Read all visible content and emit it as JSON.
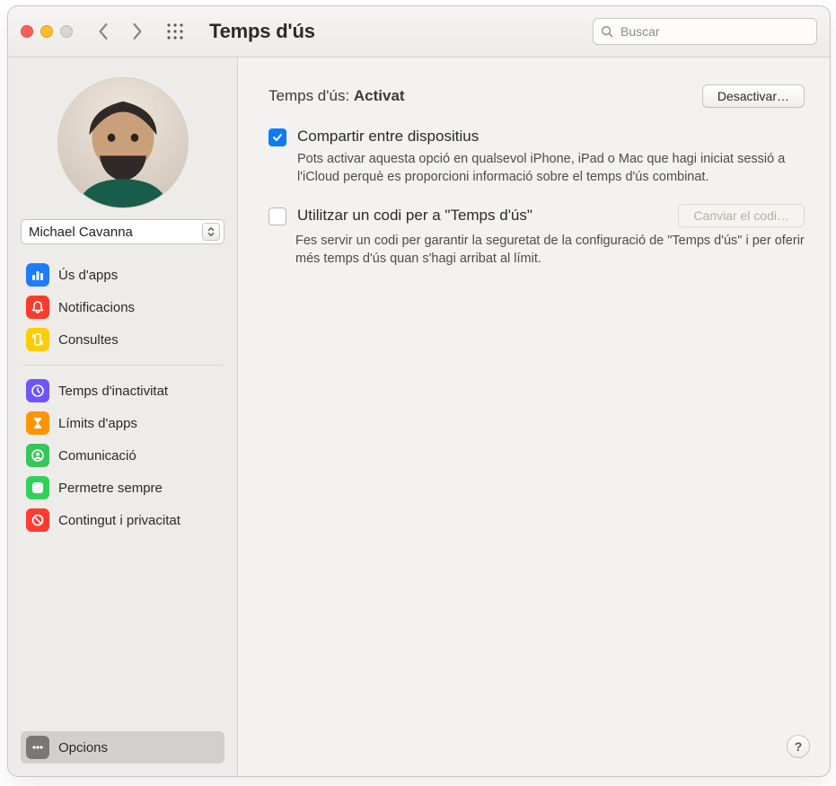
{
  "window": {
    "title": "Temps d'ús"
  },
  "search": {
    "placeholder": "Buscar"
  },
  "user": {
    "name": "Michael Cavanna"
  },
  "sidebar": {
    "group1": [
      {
        "key": "app-usage",
        "label": "Ús d'apps",
        "icon": "bar-chart-icon",
        "color": "#1f7bff"
      },
      {
        "key": "notifications",
        "label": "Notificacions",
        "icon": "bell-icon",
        "color": "#ff3b30"
      },
      {
        "key": "pickups",
        "label": "Consultes",
        "icon": "phone-swap-icon",
        "color": "#ffcc00"
      }
    ],
    "group2": [
      {
        "key": "downtime",
        "label": "Temps d'inactivitat",
        "icon": "clock-moon-icon",
        "color": "#6d55ff"
      },
      {
        "key": "app-limits",
        "label": "Límits d'apps",
        "icon": "hourglass-icon",
        "color": "#ff9500"
      },
      {
        "key": "communication",
        "label": "Comunicació",
        "icon": "person-circle-icon",
        "color": "#34c759"
      },
      {
        "key": "always-allowed",
        "label": "Permetre sempre",
        "icon": "check-shield-icon",
        "color": "#30d158"
      },
      {
        "key": "content-privacy",
        "label": "Contingut i privacitat",
        "icon": "no-sign-icon",
        "color": "#ff3b30"
      }
    ],
    "bottom": {
      "key": "options",
      "label": "Opcions",
      "icon": "ellipsis-icon",
      "color": "#7a7875",
      "selected": true
    }
  },
  "content": {
    "status_label": "Temps d'ús:",
    "status_value": "Activat",
    "deactivate_button": "Desactivar…",
    "share": {
      "checked": true,
      "title": "Compartir entre dispositius",
      "desc": "Pots activar aquesta opció en qualsevol iPhone, iPad o Mac que hagi iniciat sessió a l'iCloud perquè es proporcioni informació sobre el temps d'ús combinat."
    },
    "code": {
      "checked": false,
      "title": "Utilitzar un codi per a \"Temps d'ús\"",
      "change_button": "Canviar el codi…",
      "change_disabled": true,
      "desc": "Fes servir un codi per garantir la seguretat de la configuració de \"Temps d'ús\" i per oferir més temps d'ús quan s'hagi arribat al límit."
    }
  },
  "help_glyph": "?"
}
